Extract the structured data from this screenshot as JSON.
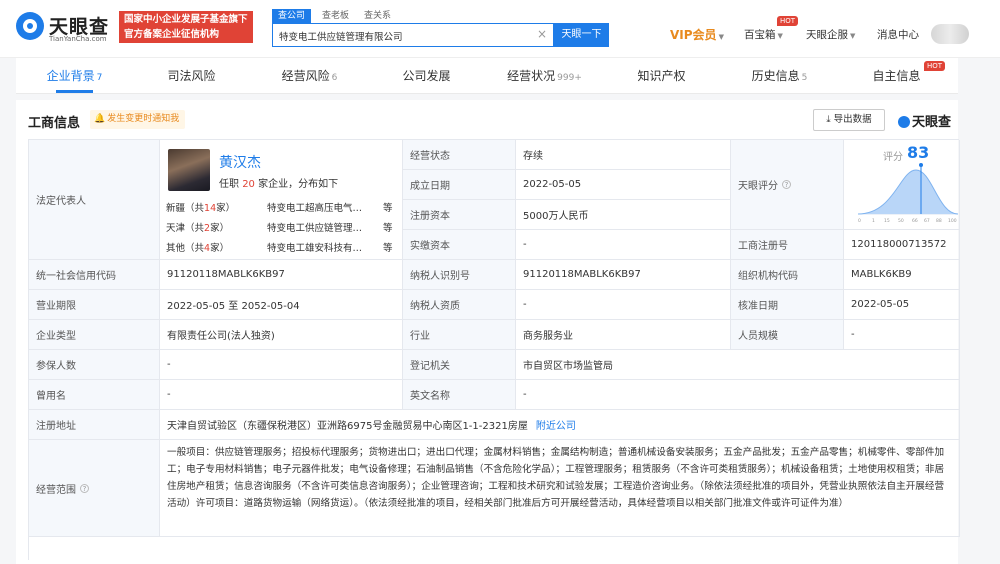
{
  "header": {
    "logo_name": "天眼查",
    "logo_domain": "TianYanCha.com",
    "slogan_line1": "国家中小企业发展子基金旗下",
    "slogan_line2": "官方备案企业征信机构",
    "search_tabs": [
      "查公司",
      "查老板",
      "查关系"
    ],
    "search_value": "特变电工供应链管理有限公司",
    "search_button": "天眼一下",
    "vip": "VIP会员",
    "treasure": "百宝箱",
    "hot": "HOT",
    "enterprise": "天眼企服",
    "messages": "消息中心"
  },
  "tabs": [
    {
      "label": "企业背景",
      "count": "7"
    },
    {
      "label": "司法风险",
      "count": ""
    },
    {
      "label": "经营风险",
      "count": "6"
    },
    {
      "label": "公司发展",
      "count": ""
    },
    {
      "label": "经营状况",
      "count": "999+"
    },
    {
      "label": "知识产权",
      "count": ""
    },
    {
      "label": "历史信息",
      "count": "5"
    },
    {
      "label": "自主信息",
      "count": ""
    }
  ],
  "tabs_hot": "HOT",
  "section": {
    "title": "工商信息",
    "notice": "发生变更时通知我",
    "export": "导出数据",
    "brand": "天眼查"
  },
  "rep": {
    "label": "法定代表人",
    "name": "黄汉杰",
    "sub_prefix": "任职",
    "sub_count": "20",
    "sub_suffix": "家企业，分布如下",
    "rows": [
      {
        "region": "新疆",
        "pre": "（共",
        "n": "14",
        "post": "家）",
        "firm": "特变电工超高压电气…",
        "etc": "等"
      },
      {
        "region": "天津",
        "pre": "（共",
        "n": "2",
        "post": "家）",
        "firm": "特变电工供应链管理…",
        "etc": "等"
      },
      {
        "region": "其他",
        "pre": "（共",
        "n": "4",
        "post": "家）",
        "firm": "特变电工雄安科技有…",
        "etc": "等"
      }
    ]
  },
  "fields": {
    "status_l": "经营状态",
    "status_v": "存续",
    "estab_l": "成立日期",
    "estab_v": "2022-05-05",
    "capital_l": "注册资本",
    "capital_v": "5000万人民币",
    "paid_l": "实缴资本",
    "paid_v": "-",
    "score_l": "天眼评分",
    "score_title": "评分",
    "score_value": "83",
    "score_axis": [
      "0",
      "1",
      "15",
      "50",
      "66",
      "67",
      "88",
      "100"
    ],
    "regno_l": "工商注册号",
    "regno_v": "120118000713572",
    "uscc_l": "统一社会信用代码",
    "uscc_v": "91120118MABLK6KB97",
    "taxid_l": "纳税人识别号",
    "taxid_v": "91120118MABLK6KB97",
    "org_l": "组织机构代码",
    "org_v": "MABLK6KB9",
    "term_l": "营业期限",
    "term_v": "2022-05-05 至 2052-05-04",
    "taxq_l": "纳税人资质",
    "taxq_v": "-",
    "approve_l": "核准日期",
    "approve_v": "2022-05-05",
    "type_l": "企业类型",
    "type_v": "有限责任公司(法人独资)",
    "industry_l": "行业",
    "industry_v": "商务服务业",
    "staff_l": "人员规模",
    "staff_v": "-",
    "insured_l": "参保人数",
    "insured_v": "-",
    "authority_l": "登记机关",
    "authority_v": "市自贸区市场监管局",
    "former_l": "曾用名",
    "former_v": "-",
    "en_l": "英文名称",
    "en_v": "-",
    "addr_l": "注册地址",
    "addr_v": "天津自贸试验区（东疆保税港区）亚洲路6975号金融贸易中心南区1-1-2321房屋",
    "addr_link": "附近公司",
    "scope_l": "经营范围",
    "scope_v": "一般项目：供应链管理服务；招投标代理服务；货物进出口；进出口代理；金属材料销售；金属结构制造；普通机械设备安装服务；五金产品批发；五金产品零售；机械零件、零部件加工；电子专用材料销售；电子元器件批发；电气设备修理；石油制品销售（不含危险化学品）；工程管理服务；租赁服务（不含许可类租赁服务）；机械设备租赁；土地使用权租赁；非居住房地产租赁；信息咨询服务（不含许可类信息咨询服务）；企业管理咨询；工程和技术研究和试验发展；工程造价咨询业务。（除依法须经批准的项目外，凭营业执照依法自主开展经营活动）许可项目：道路货物运输（网络货运）。（依法须经批准的项目，经相关部门批准后方可开展经营活动，具体经营项目以相关部门批准文件或许可证件为准）"
  },
  "colors": {
    "primary": "#1e7ce8",
    "danger": "#e04336",
    "vip": "#e88a1e"
  }
}
